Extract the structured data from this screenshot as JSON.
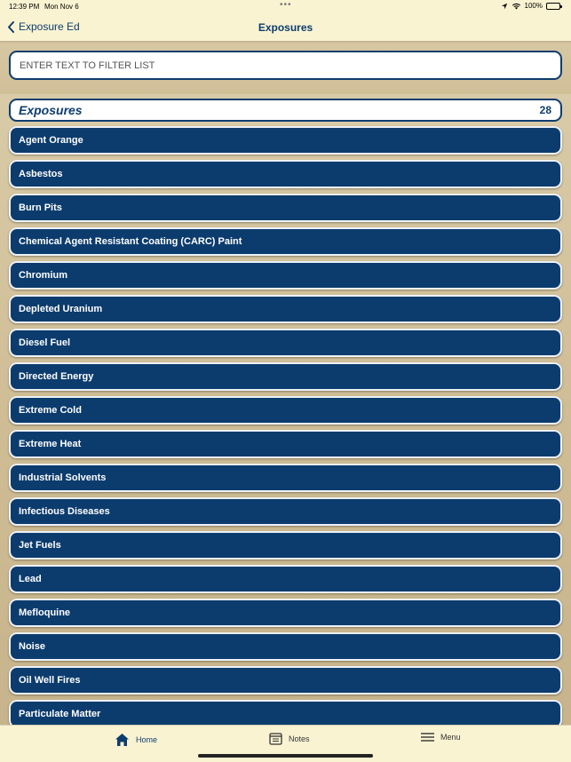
{
  "status_bar": {
    "time": "12:39 PM",
    "date": "Mon Nov 6",
    "battery": "100%"
  },
  "nav": {
    "back_label": "Exposure Ed",
    "title": "Exposures"
  },
  "search": {
    "placeholder": "ENTER TEXT TO FILTER LIST",
    "value": ""
  },
  "section": {
    "title": "Exposures",
    "count": "28"
  },
  "items": [
    "Agent Orange",
    "Asbestos",
    "Burn Pits",
    "Chemical Agent Resistant Coating (CARC) Paint",
    "Chromium",
    "Depleted Uranium",
    "Diesel Fuel",
    "Directed Energy",
    "Extreme Cold",
    "Extreme Heat",
    "Industrial Solvents",
    "Infectious Diseases",
    "Jet Fuels",
    "Lead",
    "Mefloquine",
    "Noise",
    "Oil Well Fires",
    "Particulate Matter"
  ],
  "tabs": {
    "home": "Home",
    "notes": "Notes",
    "menu": "Menu"
  },
  "colors": {
    "accent": "#0d3d6e",
    "item_bg": "#0c3c6e",
    "bar_bg": "#faf3d2"
  },
  "icons": {
    "back": "chevron-left-icon",
    "home": "home-icon",
    "notes": "notes-icon",
    "menu": "hamburger-icon"
  }
}
